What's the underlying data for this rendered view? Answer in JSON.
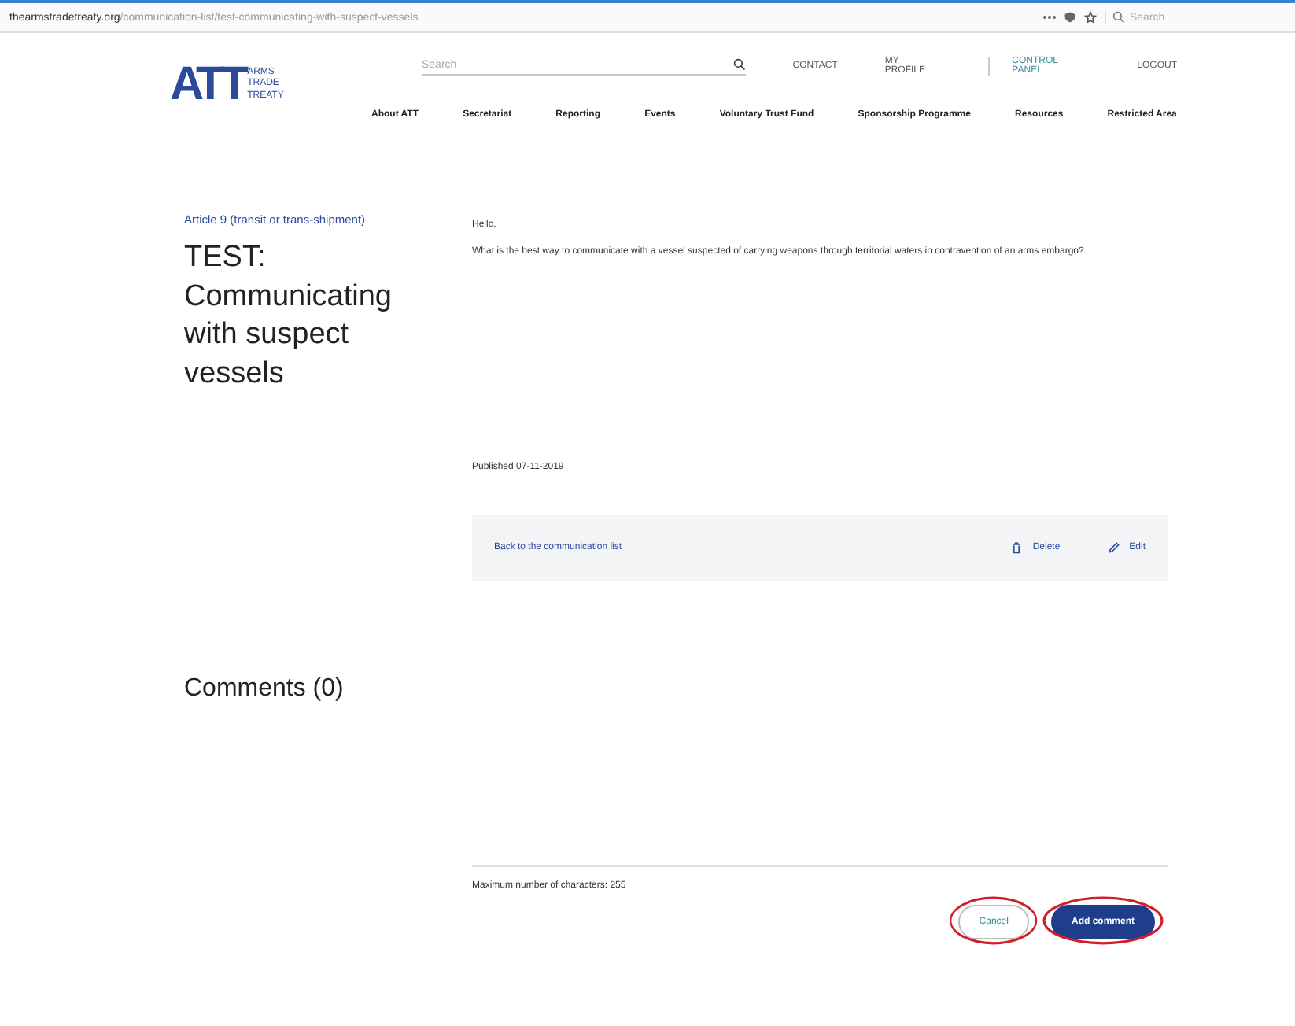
{
  "browser": {
    "url": "thearmstradetreaty.org",
    "url_rest": "/communication-list/test-communicating-with-suspect-vessels",
    "search_placeholder": "Search"
  },
  "header": {
    "logo_mark": "ATT",
    "logo_text": [
      "ARMS",
      "TRADE",
      "TREATY"
    ],
    "search_placeholder": "Search",
    "top_links": [
      {
        "label": "CONTACT",
        "kind": "link"
      },
      {
        "label": "MY PROFILE",
        "kind": "link"
      },
      {
        "label": "CONTROL PANEL",
        "kind": "panel"
      },
      {
        "label": "LOGOUT",
        "kind": "link"
      }
    ],
    "nav": [
      "About ATT",
      "Secretariat",
      "Reporting",
      "Events",
      "Voluntary Trust Fund",
      "Sponsorship Programme",
      "Resources",
      "Restricted Area"
    ]
  },
  "article": {
    "breadcrumb": "Article 9 (transit or trans-shipment)",
    "title": "TEST: Communicating with suspect vessels",
    "greeting": "Hello,",
    "body": "What is the best way to communicate with a vessel suspected of carrying weapons through territorial waters in contravention of an arms embargo?",
    "published": "Published 07-11-2019"
  },
  "actions": {
    "back": "Back to the communication list",
    "delete": "Delete",
    "edit": "Edit"
  },
  "comments": {
    "heading": "Comments (0)",
    "hint": "Maximum number of characters: 255",
    "buttons": [
      {
        "label": "Cancel",
        "kind": "secondary",
        "circled": true
      },
      {
        "label": "Add comment",
        "kind": "primary",
        "circled": true
      }
    ]
  }
}
